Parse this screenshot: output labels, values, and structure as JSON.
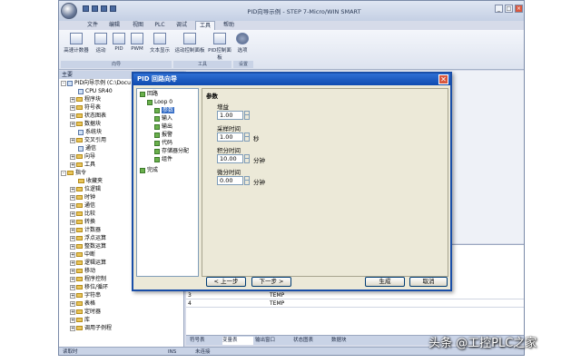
{
  "app": {
    "title": "PID向导示例 - STEP 7-Micro/WIN SMART",
    "tabs": [
      "文件",
      "编辑",
      "视图",
      "PLC",
      "调试",
      "工具",
      "帮助"
    ],
    "active_tab": "工具",
    "ribbon_buttons": [
      "高速计数器",
      "运动",
      "PID",
      "PWM",
      "文本显示",
      "运动控制面板",
      "PID控制面板",
      "选项"
    ],
    "ribbon_groups": [
      "向导",
      "工具",
      "设置"
    ]
  },
  "left_panel": {
    "header": "主要",
    "tree": [
      {
        "label": "PID向导示例 (C:\\Docu",
        "level": 0,
        "expander": "-",
        "icon": "doc"
      },
      {
        "label": "CPU SR40",
        "level": 1,
        "expander": "",
        "icon": "doc"
      },
      {
        "label": "程序块",
        "level": 1,
        "expander": "+",
        "icon": "fold"
      },
      {
        "label": "符号表",
        "level": 1,
        "expander": "+",
        "icon": "fold"
      },
      {
        "label": "状态图表",
        "level": 1,
        "expander": "+",
        "icon": "fold"
      },
      {
        "label": "数据块",
        "level": 1,
        "expander": "+",
        "icon": "fold"
      },
      {
        "label": "系统块",
        "level": 1,
        "expander": "",
        "icon": "doc"
      },
      {
        "label": "交叉引用",
        "level": 1,
        "expander": "+",
        "icon": "fold"
      },
      {
        "label": "通信",
        "level": 1,
        "expander": "",
        "icon": "doc"
      },
      {
        "label": "向导",
        "level": 1,
        "expander": "+",
        "icon": "fold"
      },
      {
        "label": "工具",
        "level": 1,
        "expander": "+",
        "icon": "fold"
      },
      {
        "label": "指令",
        "level": 0,
        "expander": "-",
        "icon": "fold"
      },
      {
        "label": "收藏夹",
        "level": 1,
        "expander": "",
        "icon": "fold"
      },
      {
        "label": "位逻辑",
        "level": 1,
        "expander": "+",
        "icon": "fold"
      },
      {
        "label": "时钟",
        "level": 1,
        "expander": "+",
        "icon": "fold"
      },
      {
        "label": "通信",
        "level": 1,
        "expander": "+",
        "icon": "fold"
      },
      {
        "label": "比较",
        "level": 1,
        "expander": "+",
        "icon": "fold"
      },
      {
        "label": "转换",
        "level": 1,
        "expander": "+",
        "icon": "fold"
      },
      {
        "label": "计数器",
        "level": 1,
        "expander": "+",
        "icon": "fold"
      },
      {
        "label": "浮点运算",
        "level": 1,
        "expander": "+",
        "icon": "fold"
      },
      {
        "label": "整数运算",
        "level": 1,
        "expander": "+",
        "icon": "fold"
      },
      {
        "label": "中断",
        "level": 1,
        "expander": "+",
        "icon": "fold"
      },
      {
        "label": "逻辑运算",
        "level": 1,
        "expander": "+",
        "icon": "fold"
      },
      {
        "label": "移动",
        "level": 1,
        "expander": "+",
        "icon": "fold"
      },
      {
        "label": "程序控制",
        "level": 1,
        "expander": "+",
        "icon": "fold"
      },
      {
        "label": "移位/循环",
        "level": 1,
        "expander": "+",
        "icon": "fold"
      },
      {
        "label": "字符串",
        "level": 1,
        "expander": "+",
        "icon": "fold"
      },
      {
        "label": "表格",
        "level": 1,
        "expander": "+",
        "icon": "fold"
      },
      {
        "label": "定时器",
        "level": 1,
        "expander": "+",
        "icon": "fold"
      },
      {
        "label": "库",
        "level": 1,
        "expander": "+",
        "icon": "fold"
      },
      {
        "label": "调用子例程",
        "level": 1,
        "expander": "+",
        "icon": "fold"
      }
    ]
  },
  "table": {
    "rows": [
      {
        "num": "3",
        "value": "TEMP"
      },
      {
        "num": "4",
        "value": "TEMP"
      }
    ]
  },
  "bottom_tabs": [
    "符号表",
    "变量表",
    "输出窗口",
    "状态图表",
    "数据块"
  ],
  "status": {
    "left": "读取时",
    "mid": "INS",
    "right": "未连接"
  },
  "dialog": {
    "title": "PID 回路向导",
    "close": "✕",
    "tree": [
      {
        "label": "回路",
        "level": 0
      },
      {
        "label": "Loop 0",
        "level": 1
      },
      {
        "label": "参数",
        "level": 2,
        "selected": true
      },
      {
        "label": "输入",
        "level": 2
      },
      {
        "label": "输出",
        "level": 2
      },
      {
        "label": "报警",
        "level": 2
      },
      {
        "label": "代码",
        "level": 2
      },
      {
        "label": "存储器分配",
        "level": 2
      },
      {
        "label": "组件",
        "level": 2
      },
      {
        "label": "完成",
        "level": 0
      }
    ],
    "panel_title": "参数",
    "fields": [
      {
        "label": "增益",
        "value": "1.00",
        "unit": ""
      },
      {
        "label": "采样时间",
        "value": "1.00",
        "unit": "秒"
      },
      {
        "label": "积分时间",
        "value": "10.00",
        "unit": "分钟"
      },
      {
        "label": "微分时间",
        "value": "0.00",
        "unit": "分钟"
      }
    ],
    "buttons": {
      "prev": "< 上一步",
      "next": "下一步 >",
      "generate": "生成",
      "cancel": "取消"
    }
  },
  "watermark": "头条 @工控PLC之家"
}
